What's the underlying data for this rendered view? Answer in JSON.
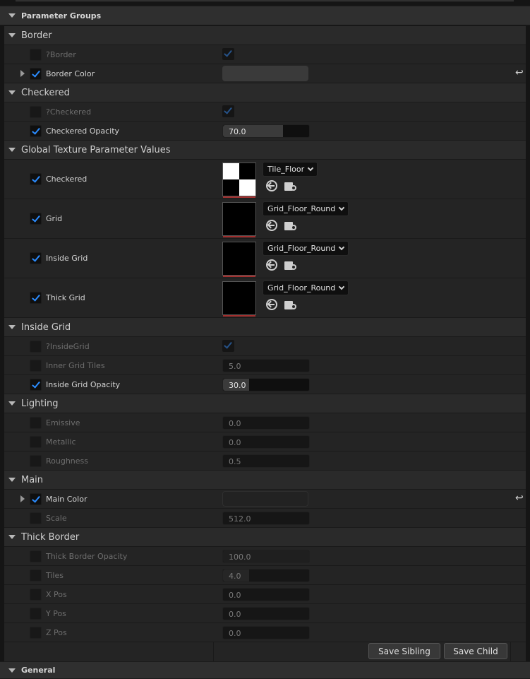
{
  "header": {
    "title": "Parameter Groups"
  },
  "footer": {
    "title": "General"
  },
  "groups": {
    "border": {
      "title": "Border",
      "rows": [
        {
          "label": "?Border"
        },
        {
          "label": "Border Color"
        }
      ]
    },
    "checkered": {
      "title": "Checkered",
      "rows": [
        {
          "label": "?Checkered"
        },
        {
          "label": "Checkered Opacity",
          "value": "70.0",
          "fill": 0.7
        }
      ]
    },
    "textures": {
      "title": "Global Texture Parameter Values",
      "rows": [
        {
          "label": "Checkered",
          "asset": "Tile_Floor"
        },
        {
          "label": "Grid",
          "asset": "Grid_Floor_Round"
        },
        {
          "label": "Inside Grid",
          "asset": "Grid_Floor_Round"
        },
        {
          "label": "Thick Grid",
          "asset": "Grid_Floor_Round"
        }
      ]
    },
    "inside_grid": {
      "title": "Inside Grid",
      "rows": [
        {
          "label": "?InsideGrid"
        },
        {
          "label": "Inner Grid Tiles",
          "value": "5.0"
        },
        {
          "label": "Inside Grid Opacity",
          "value": "30.0",
          "fill": 0.3
        }
      ]
    },
    "lighting": {
      "title": "Lighting",
      "rows": [
        {
          "label": "Emissive",
          "value": "0.0"
        },
        {
          "label": "Metallic",
          "value": "0.0"
        },
        {
          "label": "Roughness",
          "value": "0.5"
        }
      ]
    },
    "main": {
      "title": "Main",
      "rows": [
        {
          "label": "Main Color"
        },
        {
          "label": "Scale",
          "value": "512.0"
        }
      ]
    },
    "thick_border": {
      "title": "Thick Border",
      "rows": [
        {
          "label": "Thick Border Opacity",
          "value": "100.0",
          "fill": 1.0
        },
        {
          "label": "Tiles",
          "value": "4.0",
          "fill": 0.3
        },
        {
          "label": "X Pos",
          "value": "0.0"
        },
        {
          "label": "Y Pos",
          "value": "0.0"
        },
        {
          "label": "Z Pos",
          "value": "0.0"
        }
      ]
    }
  },
  "buttons": {
    "save_sibling": "Save Sibling",
    "save_child": "Save Child"
  },
  "icons": {
    "reset": "reset-arrow-icon",
    "browse": "browse-asset-icon",
    "use_selected": "use-selected-asset-icon"
  },
  "colors": {
    "accent": "#2b8cff",
    "texture_underline": "#a3302f"
  }
}
